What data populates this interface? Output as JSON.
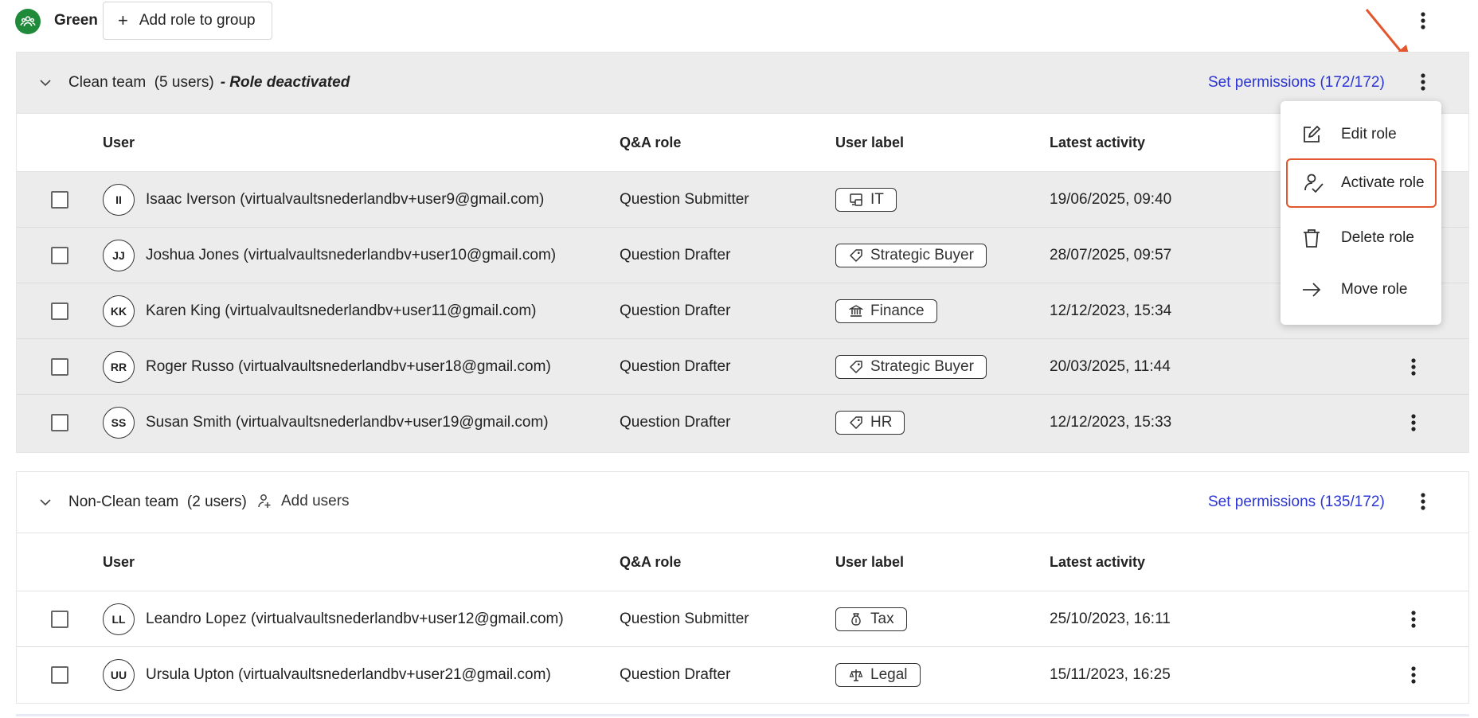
{
  "group": {
    "name": "Green",
    "add_role_label": "Add role to group"
  },
  "colors": {
    "group_icon": "#1f8b3a",
    "link": "#2b35d6",
    "deactivated_bg": "#ececec",
    "highlight_border": "#e2572e",
    "arrow": "#e2572e"
  },
  "sections": [
    {
      "title": "Clean team",
      "count": "(5 users)",
      "status": "- Role deactivated",
      "permissions": "Set permissions  (172/172)",
      "columns": {
        "user": "User",
        "qa": "Q&A role",
        "label": "User label",
        "activity": "Latest activity"
      },
      "rows": [
        {
          "initials": "II",
          "name": "Isaac Iverson (virtualvaultsnederlandbv+user9@gmail.com)",
          "qa": "Question Submitter",
          "label": "IT",
          "label_icon": "computer-icon",
          "activity": "19/06/2025, 09:40"
        },
        {
          "initials": "JJ",
          "name": "Joshua Jones (virtualvaultsnederlandbv+user10@gmail.com)",
          "qa": "Question Drafter",
          "label": "Strategic Buyer",
          "label_icon": "tag-icon",
          "activity": "28/07/2025, 09:57"
        },
        {
          "initials": "KK",
          "name": "Karen King (virtualvaultsnederlandbv+user11@gmail.com)",
          "qa": "Question Drafter",
          "label": "Finance",
          "label_icon": "bank-icon",
          "activity": "12/12/2023, 15:34"
        },
        {
          "initials": "RR",
          "name": "Roger Russo (virtualvaultsnederlandbv+user18@gmail.com)",
          "qa": "Question Drafter",
          "label": "Strategic Buyer",
          "label_icon": "tag-icon",
          "activity": "20/03/2025, 11:44"
        },
        {
          "initials": "SS",
          "name": "Susan Smith (virtualvaultsnederlandbv+user19@gmail.com)",
          "qa": "Question Drafter",
          "label": "HR",
          "label_icon": "tag-icon",
          "activity": "12/12/2023, 15:33"
        }
      ]
    },
    {
      "title": "Non-Clean team",
      "count": "(2 users)",
      "add_users_label": "Add users",
      "permissions": "Set permissions  (135/172)",
      "columns": {
        "user": "User",
        "qa": "Q&A role",
        "label": "User label",
        "activity": "Latest activity"
      },
      "rows": [
        {
          "initials": "LL",
          "name": "Leandro Lopez (virtualvaultsnederlandbv+user12@gmail.com)",
          "qa": "Question Submitter",
          "label": "Tax",
          "label_icon": "money-bag-icon",
          "activity": "25/10/2023, 16:11"
        },
        {
          "initials": "UU",
          "name": "Ursula Upton (virtualvaultsnederlandbv+user21@gmail.com)",
          "qa": "Question Drafter",
          "label": "Legal",
          "label_icon": "scales-icon",
          "activity": "15/11/2023, 16:25"
        }
      ]
    }
  ],
  "menu": {
    "items": [
      {
        "label": "Edit role",
        "icon": "edit-icon"
      },
      {
        "label": "Activate role",
        "icon": "user-check-icon"
      },
      {
        "label": "Delete role",
        "icon": "trash-icon"
      },
      {
        "label": "Move role",
        "icon": "arrow-right-icon"
      }
    ]
  }
}
